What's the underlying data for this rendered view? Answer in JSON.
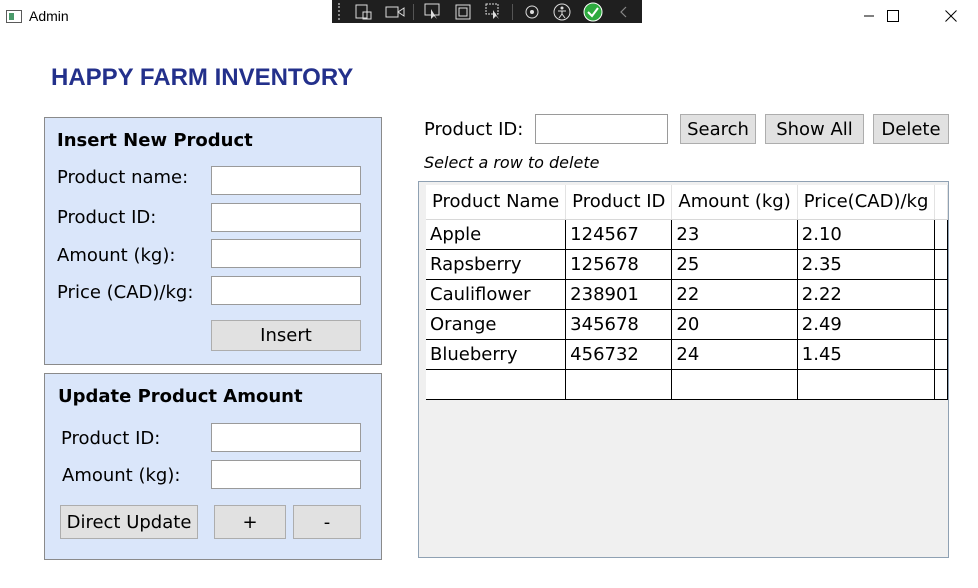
{
  "window": {
    "title": "Admin"
  },
  "header": {
    "title": "HAPPY FARM INVENTORY"
  },
  "insert_panel": {
    "title": "Insert New Product",
    "product_name_label": "Product name:",
    "product_id_label": "Product ID:",
    "amount_label": "Amount (kg):",
    "price_label": "Price (CAD)/kg:",
    "product_name_value": "",
    "product_id_value": "",
    "amount_value": "",
    "price_value": "",
    "insert_button": "Insert"
  },
  "update_panel": {
    "title": "Update Product Amount",
    "product_id_label": "Product ID:",
    "amount_label": "Amount (kg):",
    "product_id_value": "",
    "amount_value": "",
    "direct_update_button": "Direct Update",
    "plus_button": "+",
    "minus_button": "-"
  },
  "search": {
    "label": "Product ID:",
    "value": "",
    "search_button": "Search",
    "show_all_button": "Show All",
    "delete_button": "Delete",
    "hint": "Select a row to delete"
  },
  "grid": {
    "columns": [
      "Product Name",
      "Product ID",
      "Amount (kg)",
      "Price(CAD)/kg"
    ],
    "rows": [
      [
        "Apple",
        "124567",
        "23",
        "2.10"
      ],
      [
        "Rapsberry",
        "125678",
        "25",
        "2.35"
      ],
      [
        "Cauliflower",
        "238901",
        "22",
        "2.22"
      ],
      [
        "Orange",
        "345678",
        "20",
        "2.49"
      ],
      [
        "Blueberry",
        "456732",
        "24",
        "1.45"
      ],
      [
        "",
        "",
        "",
        ""
      ]
    ]
  },
  "colors": {
    "heading": "#23308b",
    "panel_bg": "#dae6fa",
    "button_bg": "#e1e1e1"
  }
}
